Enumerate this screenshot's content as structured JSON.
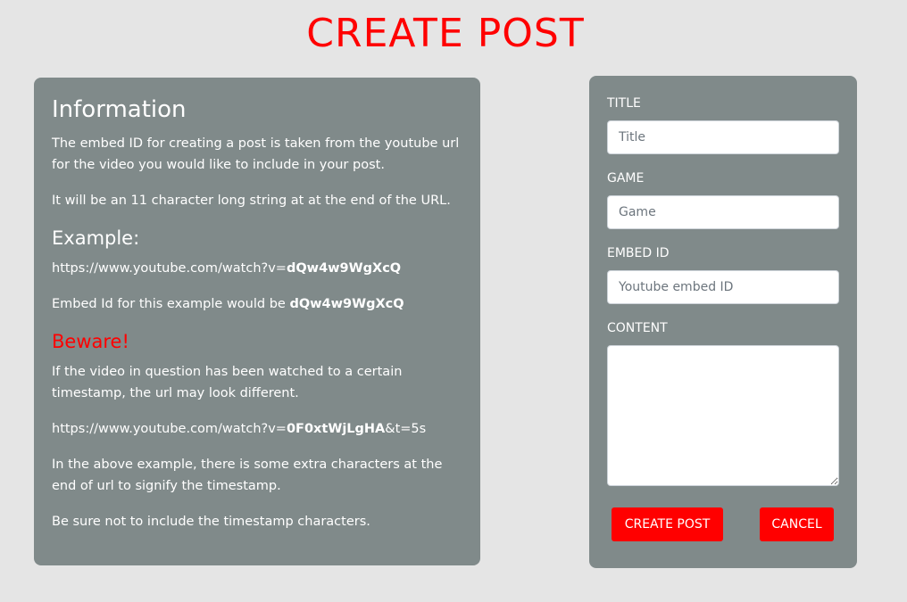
{
  "page": {
    "title": "CREATE POST"
  },
  "info": {
    "heading": "Information",
    "p1": "The embed ID for creating a post is taken from the youtube url for the video you would like to include in your post.",
    "p2": "It will be an 11 character long string at at the end of the URL.",
    "example_heading": "Example:",
    "example_url_prefix": "https://www.youtube.com/watch?v=",
    "example_id": "dQw4w9WgXcQ",
    "example_sentence_prefix": "Embed Id for this example would be ",
    "example_sentence_id": "dQw4w9WgXcQ",
    "beware_heading": "Beware!",
    "p3": "If the video in question has been watched to a certain timestamp, the url may look different.",
    "timestamp_url_prefix": "https://www.youtube.com/watch?v=",
    "timestamp_id": "0F0xtWjLgHA",
    "timestamp_suffix": "&t=5s",
    "p4": "In the above example, there is some extra characters at the end of url to signify the timestamp.",
    "p5": "Be sure not to include the timestamp characters."
  },
  "form": {
    "title_label": "TITLE",
    "title_placeholder": "Title",
    "game_label": "GAME",
    "game_placeholder": "Game",
    "embed_label": "EMBED ID",
    "embed_placeholder": "Youtube embed ID",
    "content_label": "CONTENT",
    "create_button": "CREATE POST",
    "cancel_button": "CANCEL"
  },
  "colors": {
    "accent": "#ff0000",
    "panel": "#808a8a",
    "background": "#e5e5e5"
  }
}
